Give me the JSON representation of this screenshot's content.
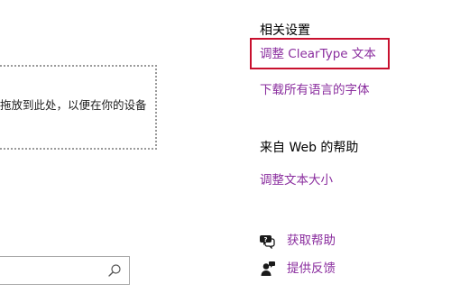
{
  "main": {
    "drop_zone_text": "拖放到此处，以便在你的设备",
    "search": {
      "value": "",
      "placeholder": ""
    }
  },
  "related_settings": {
    "heading": "相关设置",
    "links": [
      "调整 ClearType 文本",
      "下载所有语言的字体"
    ]
  },
  "web_help": {
    "heading": "来自 Web 的帮助",
    "links": [
      "调整文本大小"
    ]
  },
  "support": {
    "get_help": "获取帮助",
    "give_feedback": "提供反馈"
  },
  "colors": {
    "link": "#8a2d9e",
    "highlight": "#c8102e"
  },
  "icons": {
    "search": "search-icon",
    "get_help": "chat-help-icon",
    "feedback": "feedback-person-icon"
  }
}
